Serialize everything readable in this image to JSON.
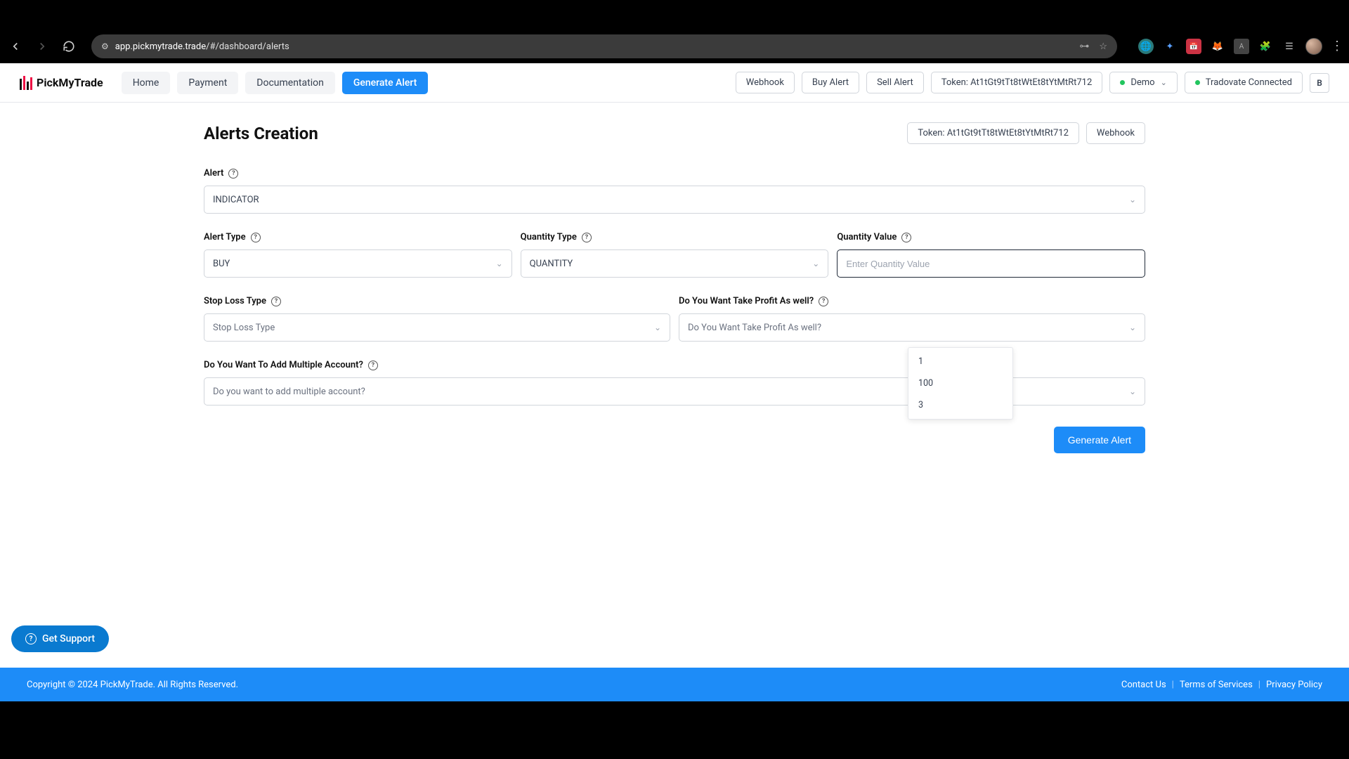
{
  "browser": {
    "url_host": "app.pickmytrade.trade",
    "url_path": "/#/dashboard/alerts"
  },
  "logo_text": "PickMyTrade",
  "nav": {
    "home": "Home",
    "payment": "Payment",
    "documentation": "Documentation",
    "generate_alert": "Generate Alert"
  },
  "header": {
    "webhook": "Webhook",
    "buy_alert": "Buy Alert",
    "sell_alert": "Sell Alert",
    "token_label": "Token: At1tGt9tTt8tWtEt8tYtMtRt712",
    "account_mode": "Demo",
    "connection_status": "Tradovate Connected",
    "avatar_initial": "B"
  },
  "title": "Alerts Creation",
  "title_chips": {
    "token": "Token: At1tGt9tTt8tWtEt8tYtMtRt712",
    "webhook": "Webhook"
  },
  "labels": {
    "alert": "Alert",
    "alert_type": "Alert Type",
    "quantity_type": "Quantity Type",
    "quantity_value": "Quantity Value",
    "stop_loss_type": "Stop Loss Type",
    "take_profit": "Do You Want Take Profit As well?",
    "multiple_account": "Do You Want To Add Multiple Account?"
  },
  "values": {
    "alert": "INDICATOR",
    "alert_type": "BUY",
    "quantity_type": "QUANTITY",
    "quantity_value_placeholder": "Enter Quantity Value",
    "stop_loss_type": "Stop Loss Type",
    "take_profit": "Do You Want Take Profit As well?",
    "multiple_account": "Do you want to add multiple account?"
  },
  "autocomplete": [
    "1",
    "100",
    "3"
  ],
  "buttons": {
    "generate_alert": "Generate Alert",
    "get_support": "Get Support"
  },
  "footer": {
    "copyright": "Copyright © 2024 PickMyTrade. All Rights Reserved.",
    "links": {
      "contact": "Contact Us",
      "terms": "Terms of Services",
      "privacy": "Privacy Policy"
    }
  }
}
